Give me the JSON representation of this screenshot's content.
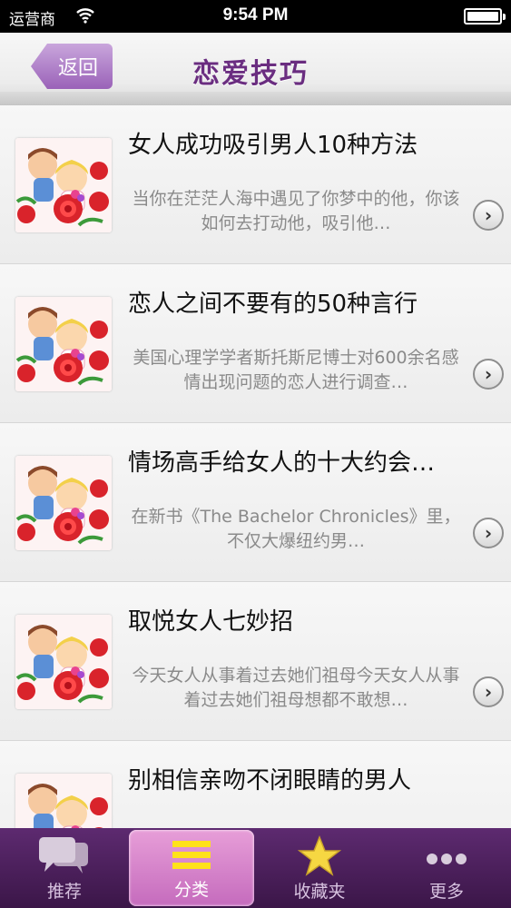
{
  "status_bar": {
    "carrier": "运营商",
    "time": "9:54 PM"
  },
  "nav": {
    "back_label": "返回",
    "title": "恋爱技巧"
  },
  "articles": [
    {
      "title": "女人成功吸引男人10种方法",
      "summary": "当你在茫茫人海中遇见了你梦中的他，你该如何去打动他，吸引他…"
    },
    {
      "title": "恋人之间不要有的50种言行",
      "summary": "美国心理学学者斯托斯尼博士对600余名感情出现问题的恋人进行调查…"
    },
    {
      "title": "情场高手给女人的十大约会…",
      "summary": "在新书《The Bachelor Chronicles》里，不仅大爆纽约男…"
    },
    {
      "title": "取悦女人七妙招",
      "summary": "今天女人从事着过去她们祖母今天女人从事着过去她们祖母想都不敢想…"
    },
    {
      "title": "别相信亲吻不闭眼睛的男人",
      "summary": ""
    }
  ],
  "tabs": [
    {
      "label": "推荐",
      "icon": "chat-bubbles-icon"
    },
    {
      "label": "分类",
      "icon": "category-bars-icon",
      "active": true
    },
    {
      "label": "收藏夹",
      "icon": "star-icon"
    },
    {
      "label": "更多",
      "icon": "more-dots-icon"
    }
  ],
  "colors": {
    "accent": "#6a2d80",
    "tab_bar": "#4a1e5a",
    "tab_active": "#d884cc",
    "back_button": "#a870c4"
  }
}
